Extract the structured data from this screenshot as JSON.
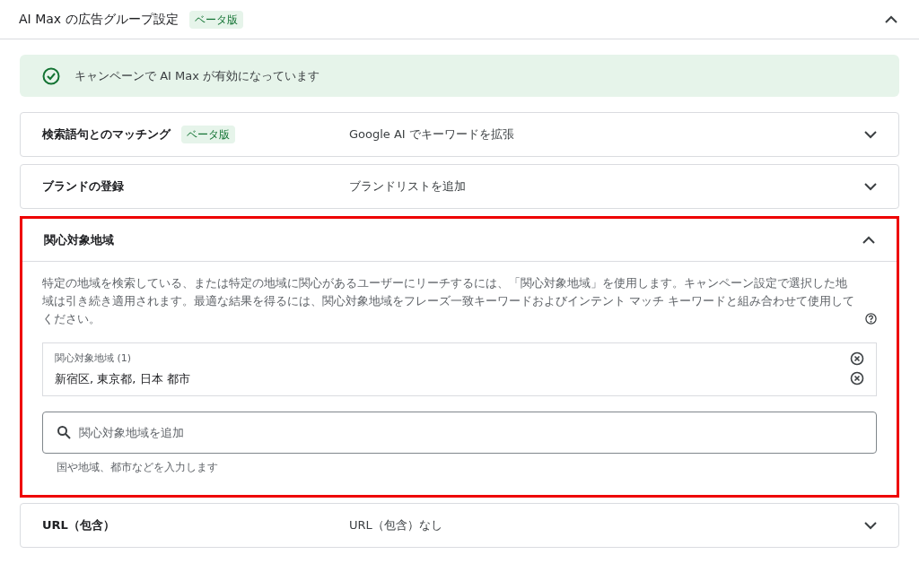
{
  "header": {
    "title": "AI Max の広告グループ設定",
    "badge": "ベータ版",
    "expanded": true
  },
  "banner": {
    "text": "キャンペーンで AI Max が有効になっています"
  },
  "sections": [
    {
      "title": "検索語句とのマッチング",
      "badge": "ベータ版",
      "summary": "Google AI でキーワードを拡張",
      "expanded": false,
      "highlighted": false
    },
    {
      "title": "ブランドの登録",
      "summary": "ブランドリストを追加",
      "expanded": false,
      "highlighted": false
    },
    {
      "title": "関心対象地域",
      "expanded": true,
      "highlighted": true,
      "description": "特定の地域を検索している、または特定の地域に関心があるユーザーにリーチするには、「関心対象地域」を使用します。キャンペーン設定で選択した地域は引き続き適用されます。最適な結果を得るには、関心対象地域をフレーズ一致キーワードおよびインテント マッチ キーワードと組み合わせて使用してください。",
      "selected_label": "関心対象地域 (1)",
      "selected_value": "新宿区, 東京都, 日本 都市",
      "search_placeholder": "関心対象地域を追加",
      "search_hint": "国や地域、都市などを入力します"
    },
    {
      "title": "URL（包含）",
      "summary": "URL（包含）なし",
      "expanded": false,
      "highlighted": false
    }
  ]
}
